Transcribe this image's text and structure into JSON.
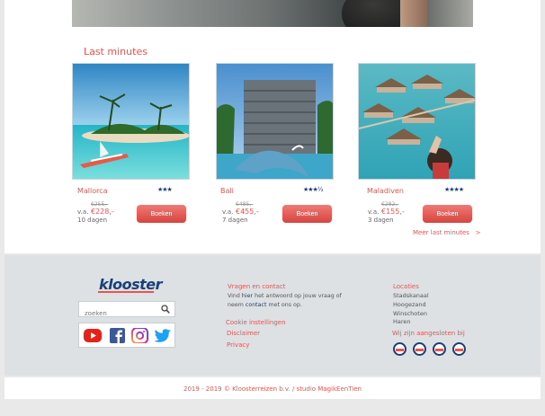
{
  "section": {
    "title": "Last minutes"
  },
  "offers": [
    {
      "destination": "Mallorca",
      "stars": "★★★",
      "old_price": "€255,-",
      "va": "v.a.",
      "new_price": "€228,-",
      "duration": "10 dagen",
      "button": "Boeken"
    },
    {
      "destination": "Bali",
      "stars": "★★★½",
      "old_price": "€485,-",
      "va": "v.a.",
      "new_price": "€455,-",
      "duration": "7 dagen",
      "button": "Boeken"
    },
    {
      "destination": "Maladiven",
      "stars": "★★★★",
      "old_price": "€282,-",
      "va": "v.a.",
      "new_price": "€155,-",
      "duration": "3 dagen",
      "button": "Boeken"
    }
  ],
  "more_link": "Meer last minutes   >",
  "footer": {
    "logo": "klooster",
    "search_placeholder": "zoeken",
    "contact_heading": "Vragen en contact",
    "contact_text_1": "Vind ",
    "contact_link_1": "hier",
    "contact_text_2": " het antwoord op jouw vraag of",
    "contact_text_3": "neem ",
    "contact_link_2": "contact",
    "contact_text_4": " met ons op.",
    "links": [
      "Cookie instellingen",
      "Disclaimer",
      "Privacy"
    ],
    "locations_heading": "Locaties",
    "locations": [
      "Stadskanaal",
      "Hoogezand",
      "Winschoten",
      "Haren"
    ],
    "affiliated_heading": "Wij zijn aangesloten bij",
    "copyright": "2019 - 2019 © Kloosterreizen b.v. / studio MagikEenTien"
  },
  "colors": {
    "accent": "#e9544f",
    "brand": "#1b3f77"
  },
  "icons": [
    "search-icon",
    "youtube-icon",
    "facebook-icon",
    "instagram-icon",
    "twitter-icon"
  ]
}
